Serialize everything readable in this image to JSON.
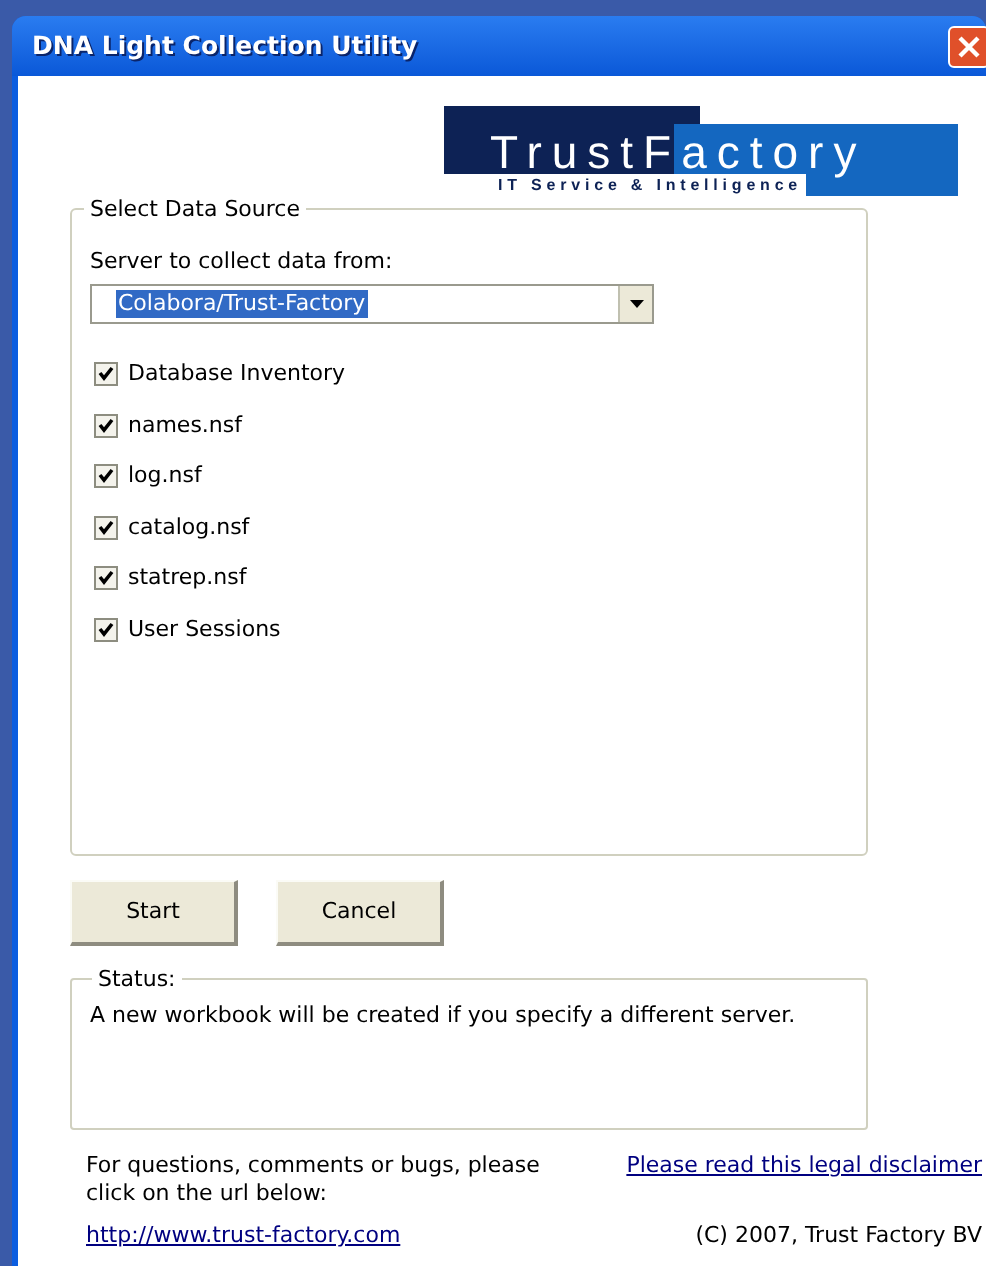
{
  "window": {
    "title": "DNA Light Collection Utility"
  },
  "logo": {
    "parts": [
      "Trust",
      "Factory"
    ],
    "tagline": "IT Service & Intelligence"
  },
  "data_source": {
    "legend": "Select Data Source",
    "server_label": "Server to collect data from:",
    "server": {
      "value": "Colabora/Trust-Factory"
    },
    "options": [
      {
        "label": "Database Inventory",
        "checked": true
      },
      {
        "label": "names.nsf",
        "checked": true
      },
      {
        "label": "log.nsf",
        "checked": true
      },
      {
        "label": "catalog.nsf",
        "checked": true
      },
      {
        "label": "statrep.nsf",
        "checked": true
      },
      {
        "label": "User Sessions",
        "checked": true
      }
    ]
  },
  "buttons": [
    "Start",
    "Cancel"
  ],
  "status": {
    "legend": "Status:",
    "message": "A new workbook will be created if you specify a different server."
  },
  "footer": {
    "note": "For questions, comments or bugs, please click on the url below:",
    "url": "http://www.trust-factory.com",
    "disclaimer_link": "Please read this legal disclaimer",
    "copyright": "(C) 2007, Trust Factory BV"
  }
}
